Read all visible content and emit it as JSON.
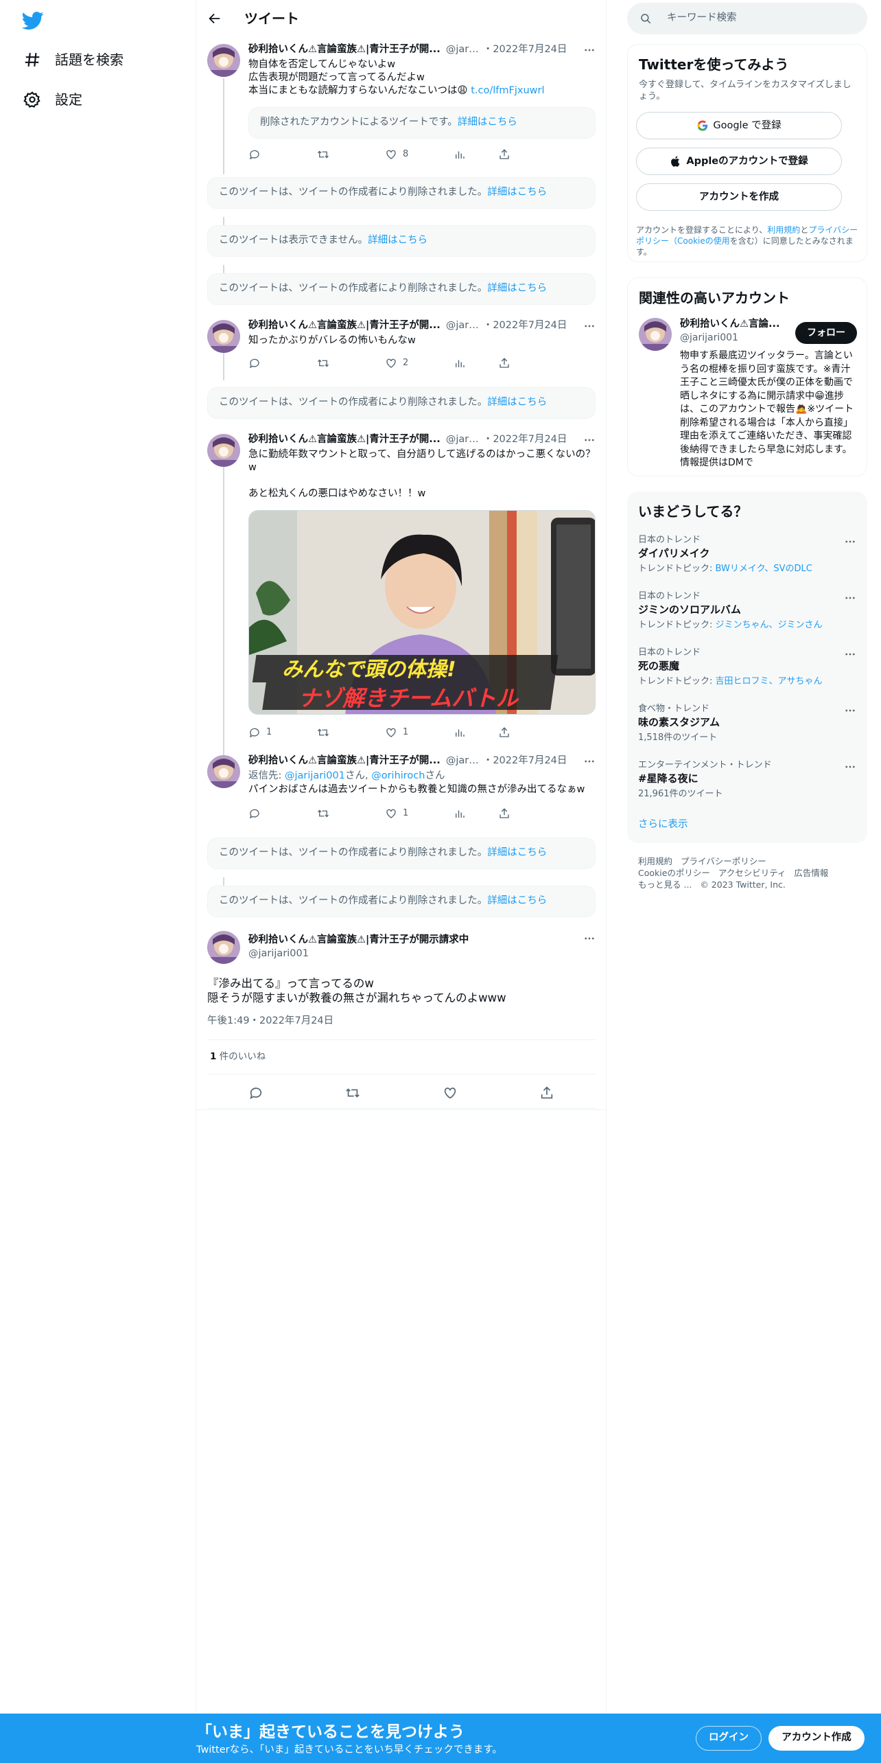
{
  "nav": {
    "explore_label": "話題を検索",
    "settings_label": "設定"
  },
  "header": {
    "title": "ツイート"
  },
  "tweets": [
    {
      "name": "砂利拾いくん⚠言論蛮族⚠|青汁王子が開...",
      "handle": "@jarij...",
      "date": "・2022年7月24日",
      "lines": [
        "物自体を否定してんじゃないよw",
        "広告表現が問題だって言ってるんだよw",
        "本当にまともな読解力すらないんだなこいつは😩 "
      ],
      "link": "t.co/lfmFjxuwrl",
      "quote_text": "削除されたアカウントによるツイートです。",
      "quote_link": "詳細はこちら",
      "likes": "8"
    },
    {
      "name": "砂利拾いくん⚠言論蛮族⚠|青汁王子が開...",
      "handle": "@jarij...",
      "date": "・2022年7月24日",
      "lines": [
        "知ったかぶりがバレるの怖いもんなw"
      ],
      "likes": "2"
    },
    {
      "name": "砂利拾いくん⚠言論蛮族⚠|青汁王子が開...",
      "handle": "@jarij...",
      "date": "・2022年7月24日",
      "lines": [
        "急に勤続年数マウントと取って、自分語りして逃げるのはかっこ悪くないの？w",
        "",
        "あと松丸くんの悪口はやめなさい！！w"
      ],
      "image_caption_1": "みんなで頭の体操!",
      "image_caption_2": "ナゾ解きチームバトル",
      "replies": "1",
      "likes": "1"
    },
    {
      "name": "砂利拾いくん⚠言論蛮族⚠|青汁王子が開...",
      "handle": "@jarij...",
      "date": "・2022年7月24日",
      "reply_prefix": "返信先: ",
      "reply_to_1": "@jarijari001",
      "reply_mid": "さん, ",
      "reply_to_2": "@orihiroch",
      "reply_suffix": "さん",
      "lines": [
        "パインおばさんは過去ツイートからも教養と知識の無さが滲み出てるなぁw"
      ],
      "likes": "1"
    }
  ],
  "deleted_notices": [
    {
      "text": "このツイートは、ツイートの作成者により削除されました。",
      "link": "詳細はこちら"
    },
    {
      "text": "このツイートは表示できません。",
      "link": "詳細はこちら"
    },
    {
      "text": "このツイートは、ツイートの作成者により削除されました。",
      "link": "詳細はこちら"
    },
    {
      "text": "このツイートは、ツイートの作成者により削除されました。",
      "link": "詳細はこちら"
    },
    {
      "text": "このツイートは、ツイートの作成者により削除されました。",
      "link": "詳細はこちら"
    },
    {
      "text": "このツイートは、ツイートの作成者により削除されました。",
      "link": "詳細はこちら"
    }
  ],
  "main_tweet": {
    "name": "砂利拾いくん⚠言論蛮族⚠|青汁王子が開示請求中",
    "handle": "@jarijari001",
    "line1": "『滲み出てる』って言ってるのw",
    "line2": "隠そうが隠すまいが教養の無さが漏れちゃってんのよwww",
    "timestamp": "午後1:49・2022年7月24日",
    "likes_count": "1",
    "likes_label": " 件のいいね"
  },
  "search": {
    "placeholder": "キーワード検索"
  },
  "signup": {
    "title": "Twitterを使ってみよう",
    "subtitle": "今すぐ登録して、タイムラインをカスタマイズしましょう。",
    "google": "Google で登録",
    "apple": "Appleのアカウントで登録",
    "create": "アカウントを作成",
    "terms_1": "アカウントを登録することにより、",
    "terms_link_1": "利用規約",
    "terms_2": "と",
    "terms_link_2": "プライバシーポリシー（Cookieの使用",
    "terms_3": "を含む）に同意したとみなされます。"
  },
  "related": {
    "title": "関連性の高いアカウント",
    "name": "砂利拾いくん⚠言論...",
    "handle": "@jarijari001",
    "follow": "フォロー",
    "bio": "物申す系最底辺ツイッタラー。言論という名の棍棒を振り回す蛮族です。※青汁王子こと三崎優太氏が僕の正体を動画で晒しネタにする為に開示請求中😁進捗は、このアカウントで報告🙇※ツイート削除希望される場合は「本人から直接」理由を添えてご連絡いただき、事実確認後納得できましたら早急に対応します。情報提供はDMで"
  },
  "trends": {
    "title": "いまどうしてる？",
    "items": [
      {
        "category": "日本のトレンド",
        "name": "ダイパリメイク",
        "topic_prefix": "トレンドトピック: ",
        "topic": "BWリメイク、SVのDLC"
      },
      {
        "category": "日本のトレンド",
        "name": "ジミンのソロアルバム",
        "topic_prefix": "トレンドトピック: ",
        "topic": "ジミンちゃん、ジミンさん"
      },
      {
        "category": "日本のトレンド",
        "name": "死の悪魔",
        "topic_prefix": "トレンドトピック: ",
        "topic": "吉田ヒロフミ、アサちゃん"
      },
      {
        "category": "食べ物・トレンド",
        "name": "味の素スタジアム",
        "count": "1,518件のツイート"
      },
      {
        "category": "エンターテインメント・トレンド",
        "name": "#星降る夜に",
        "count": "21,961件のツイート"
      }
    ],
    "show_more": "さらに表示"
  },
  "footer": {
    "terms": "利用規約",
    "privacy": "プライバシーポリシー",
    "cookie": "Cookieのポリシー",
    "access": "アクセシビリティ",
    "ads": "広告情報",
    "more": "もっと見る ...",
    "copyright": "© 2023 Twitter, Inc."
  },
  "bottombar": {
    "title": "「いま」起きていることを見つけよう",
    "subtitle": "Twitterなら、「いま」起きていることをいち早くチェックできます。",
    "login": "ログイン",
    "signup": "アカウント作成"
  },
  "colors": {
    "accent": "#1d9bf0",
    "text": "#0f1419",
    "muted": "#536471",
    "border": "#eff3f4"
  }
}
